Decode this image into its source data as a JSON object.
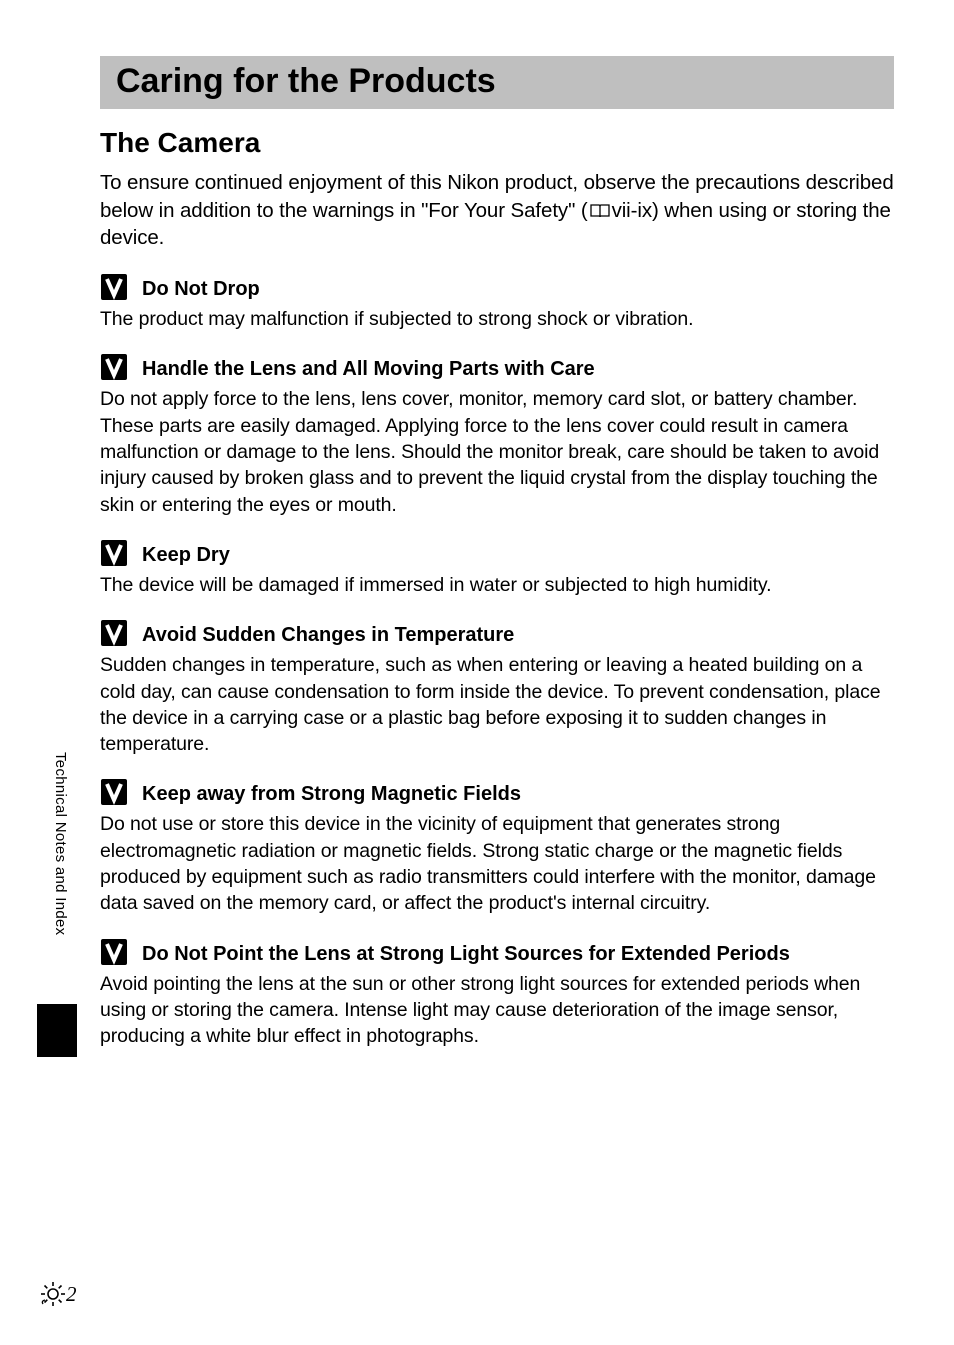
{
  "page": {
    "main_heading": "Caring for the Products",
    "sub_heading": "The Camera",
    "intro": "To ensure continued enjoyment of this Nikon product, observe the precautions described below in addition to the warnings in \"For Your Safety\" (📖vii-ix) when using or storing the device.",
    "intro_pre": "To ensure continued enjoyment of this Nikon product, observe the precautions described below in addition to the warnings in \"For Your Safety\" (",
    "intro_post": "vii-ix) when using or storing the device."
  },
  "sections": [
    {
      "title": "Do Not Drop",
      "body": "The product may malfunction if subjected to strong shock or vibration."
    },
    {
      "title": "Handle the Lens and All Moving Parts with Care",
      "body": "Do not apply force to the lens, lens cover, monitor, memory card slot, or battery chamber. These parts are easily damaged. Applying force to the lens cover could result in camera malfunction or damage to the lens. Should the monitor break, care should be taken to avoid injury caused by broken glass and to prevent the liquid crystal from the display touching the skin or entering the eyes or mouth."
    },
    {
      "title": "Keep Dry",
      "body": "The device will be damaged if immersed in water or subjected to high humidity."
    },
    {
      "title": "Avoid Sudden Changes in Temperature",
      "body": "Sudden changes in temperature, such as when entering or leaving a heated building on a cold day, can cause condensation to form inside the device. To prevent condensation, place the device in a carrying case or a plastic bag before exposing it to sudden changes in temperature."
    },
    {
      "title": "Keep away from Strong Magnetic Fields",
      "body": "Do not use or store this device in the vicinity of equipment that generates strong electromagnetic radiation or magnetic fields. Strong static charge or the magnetic fields produced by equipment such as radio transmitters could interfere with the monitor, damage data saved on the memory card, or affect the product's internal circuitry."
    },
    {
      "title": "Do Not Point the Lens at Strong Light Sources for Extended Periods",
      "body": "Avoid pointing the lens at the sun or other strong light sources for extended periods when using or storing the camera. Intense light may cause deterioration of the image sensor, producing a white blur effect in photographs."
    }
  ],
  "sidebar": {
    "label": "Technical Notes and Index"
  },
  "footer": {
    "page_number": "2"
  }
}
